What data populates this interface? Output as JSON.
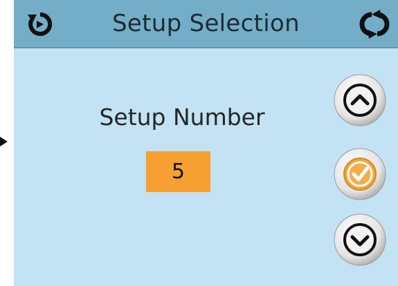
{
  "header": {
    "title": "Setup Selection",
    "back_icon": "back-refresh-icon",
    "cycle_icon": "cycle-arrows-icon"
  },
  "main": {
    "label": "Setup Number",
    "value": "5"
  },
  "buttons": {
    "up_icon": "chevron-up-icon",
    "ok_icon": "check-icon",
    "down_icon": "chevron-down-icon"
  },
  "colors": {
    "header_bg": "#74adc7",
    "screen_bg": "#c3e2f4",
    "accent_orange": "#f5a031"
  }
}
